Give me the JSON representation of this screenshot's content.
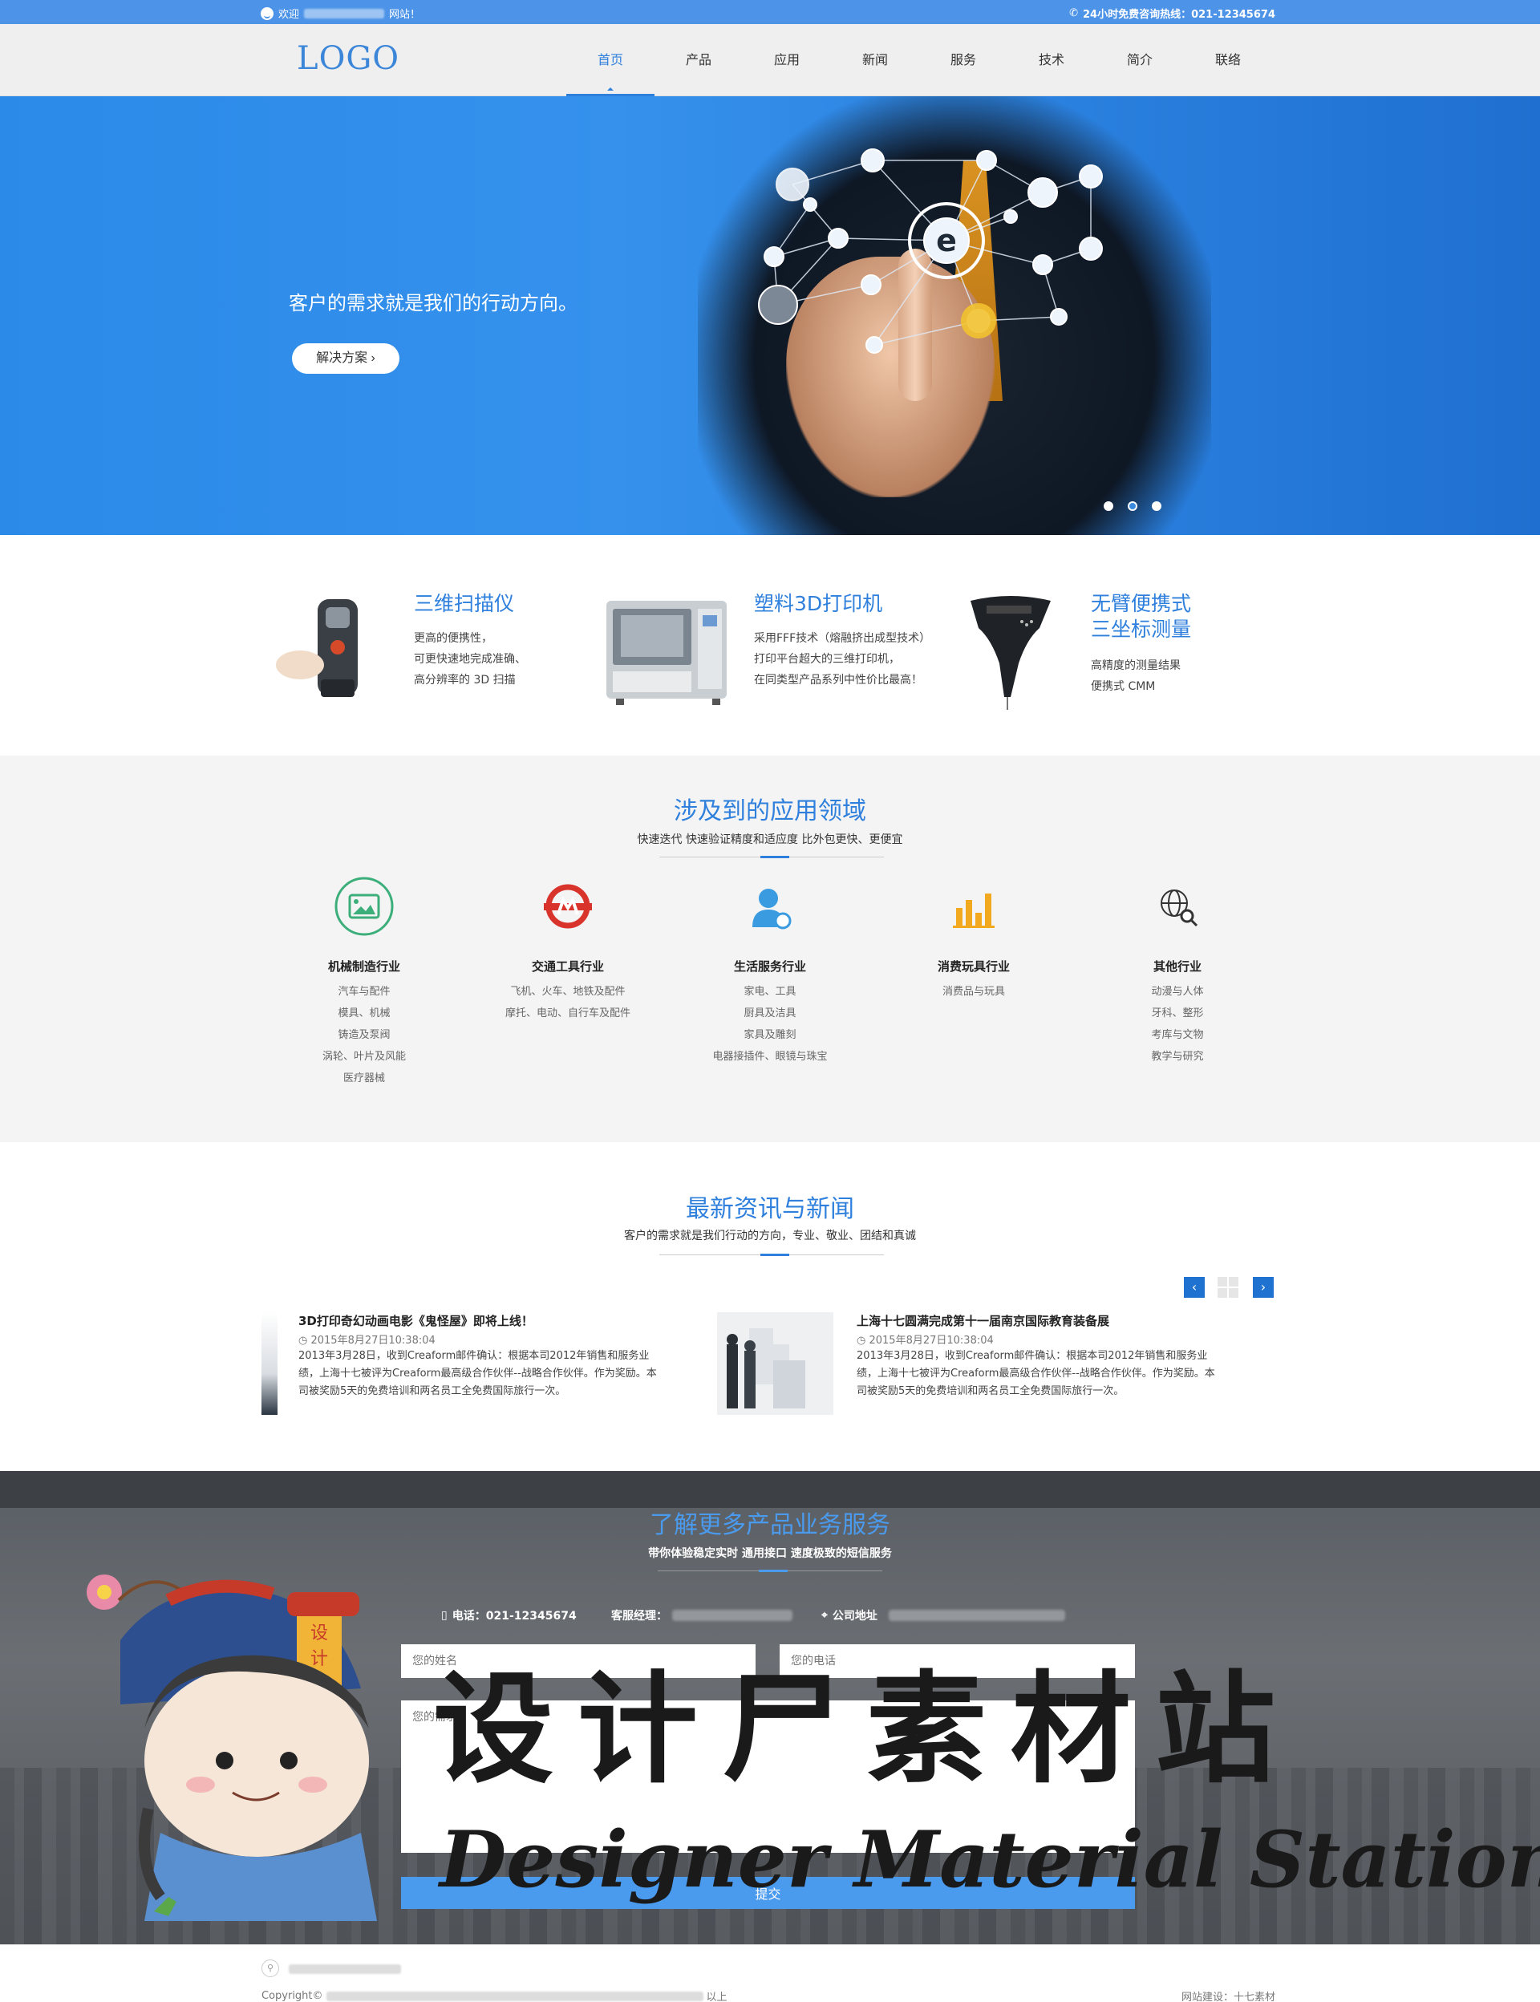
{
  "topbar": {
    "welcome_prefix": "欢迎",
    "welcome_suffix": "网站！",
    "hotline": "24小时免费咨询热线：021-12345674"
  },
  "header": {
    "logo": "LOGO",
    "nav": [
      "首页",
      "产品",
      "应用",
      "新闻",
      "服务",
      "技术",
      "简介",
      "联络"
    ],
    "active_index": 0
  },
  "hero": {
    "tagline": "客户的需求就是我们的行动方向。",
    "button_label": "解决方案 ›",
    "slides": 3,
    "active_slide": 2
  },
  "products": [
    {
      "title": "三维扫描仪",
      "lines": [
        "更高的便携性，",
        "可更快速地完成准确、",
        "高分辨率的 3D 扫描"
      ],
      "image": "3d-scanner-image"
    },
    {
      "title": "塑料3D打印机",
      "lines": [
        "采用FFF技术（熔融挤出成型技术）",
        "打印平台超大的三维打印机，",
        "在同类型产品系列中性价比最高！"
      ],
      "image": "3d-printer-image"
    },
    {
      "title_lines": [
        "无臂便携式",
        "三坐标测量"
      ],
      "lines": [
        "高精度的测量结果",
        "便携式 CMM"
      ],
      "image": "cmm-probe-image"
    }
  ],
  "apps": {
    "title": "涉及到的应用领域",
    "subtitle": "快速迭代 快速验证精度和适应度 比外包更快、更便宜",
    "columns": [
      {
        "name": "机械制造行业",
        "items": [
          "汽车与配件",
          "模具、机械",
          "铸造及泵阀",
          "涡轮、叶片及风能",
          "医疗器械"
        ],
        "icon": "machine-icon",
        "color": "#3cae7a"
      },
      {
        "name": "交通工具行业",
        "items": [
          "飞机、火车、地铁及配件",
          "摩托、电动、自行车及配件"
        ],
        "icon": "metro-icon",
        "color": "#d9342b"
      },
      {
        "name": "生活服务行业",
        "items": [
          "家电、工具",
          "厨具及洁具",
          "家具及雕刻",
          "电器接插件、眼镜与珠宝"
        ],
        "icon": "service-person-icon",
        "color": "#3a9be0"
      },
      {
        "name": "消费玩具行业",
        "items": [
          "消费品与玩具"
        ],
        "icon": "bar-chart-icon",
        "color": "#f2a91f"
      },
      {
        "name": "其他行业",
        "items": [
          "动漫与人体",
          "牙科、整形",
          "考库与文物",
          "教学与研究"
        ],
        "icon": "globe-search-icon",
        "color": "#333333"
      }
    ]
  },
  "news": {
    "title": "最新资讯与新闻",
    "subtitle": "客户的需求就是我们行动的方向，专业、敬业、团结和真诚",
    "prev": "‹",
    "next": "›",
    "items": [
      {
        "title": "3D打印奇幻动画电影《鬼怪屋》即将上线！",
        "date": "2015年8月27日10:38:04",
        "body": "2013年3月28日，收到Creaform邮件确认：根据本司2012年销售和服务业绩，上海十七被评为Creaform最高级合作伙伴--战略合作伙伴。作为奖励。本司被奖励5天的免费培训和两名员工全免费国际旅行一次。"
      },
      {
        "title": "上海十七圆满完成第十一届南京国际教育装备展",
        "date": "2015年8月27日10:38:04",
        "body": "2013年3月28日，收到Creaform邮件确认：根据本司2012年销售和服务业绩，上海十七被评为Creaform最高级合作伙伴--战略合作伙伴。作为奖励。本司被奖励5天的免费培训和两名员工全免费国际旅行一次。"
      }
    ]
  },
  "contact": {
    "title": "了解更多产品业务服务",
    "subtitle": "带你体验稳定实时 通用接口 速度极致的短信服务",
    "phone": "电话：021-12345674",
    "manager": "客服经理：",
    "address": "公司地址",
    "name_placeholder": "您的姓名",
    "phone_placeholder": "您的电话",
    "message_placeholder": "您的需求",
    "submit": "提交"
  },
  "watermark": {
    "cn": "设计尸素材站",
    "en": "Designer Material Station",
    "badge": "设计尸"
  },
  "footer": {
    "copyright": "Copyright©",
    "suffix": "以上",
    "build": "网站建设：十七素材"
  }
}
